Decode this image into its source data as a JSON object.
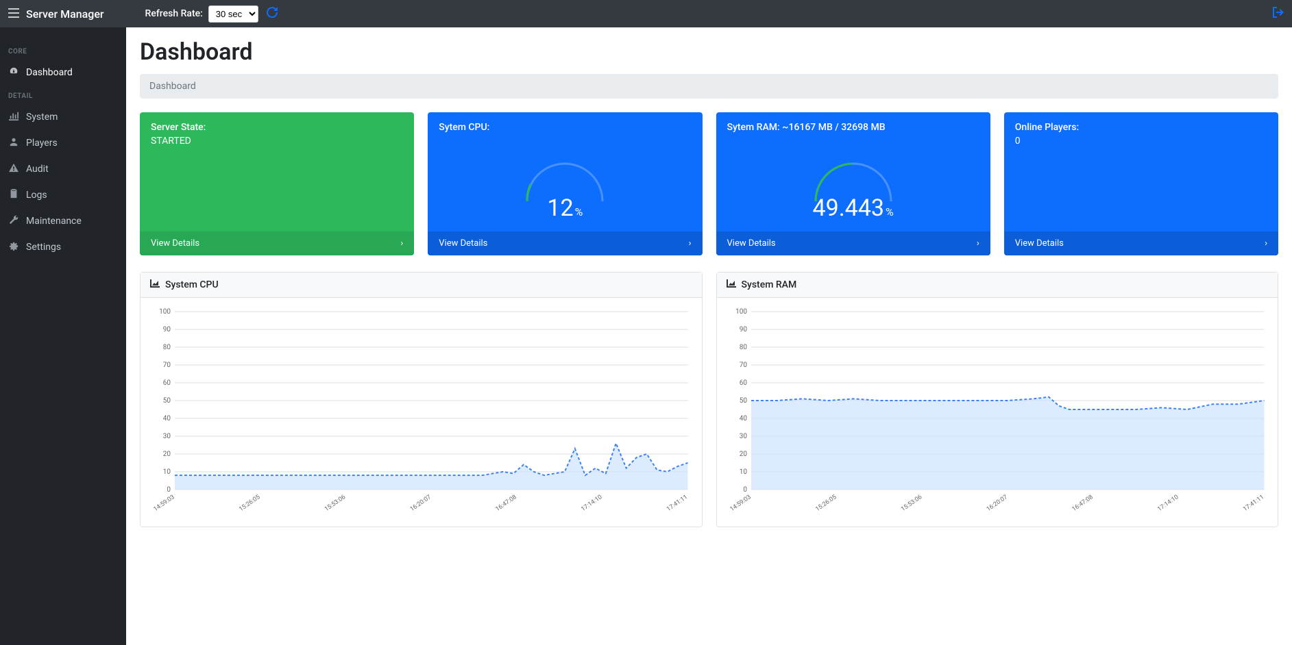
{
  "header": {
    "brand": "Server Manager",
    "refresh_label": "Refresh Rate:",
    "refresh_selected": "30 sec"
  },
  "sidebar": {
    "sections": [
      {
        "label": "CORE",
        "items": [
          {
            "icon": "gauge-icon",
            "label": "Dashboard",
            "active": true
          }
        ]
      },
      {
        "label": "DETAIL",
        "items": [
          {
            "icon": "chart-icon",
            "label": "System"
          },
          {
            "icon": "user-icon",
            "label": "Players"
          },
          {
            "icon": "warn-icon",
            "label": "Audit"
          },
          {
            "icon": "clipboard-icon",
            "label": "Logs"
          },
          {
            "icon": "wrench-icon",
            "label": "Maintenance"
          },
          {
            "icon": "cogs-icon",
            "label": "Settings"
          }
        ]
      }
    ]
  },
  "page": {
    "title": "Dashboard",
    "breadcrumb": "Dashboard"
  },
  "cards": {
    "server_state": {
      "title": "Server State:",
      "value": "STARTED",
      "footer": "View Details"
    },
    "cpu": {
      "title": "Sytem CPU:",
      "value": "12",
      "unit": "%",
      "footer": "View Details"
    },
    "ram": {
      "title": "Sytem RAM: ~16167 MB / 32698 MB",
      "value": "49.443",
      "unit": "%",
      "footer": "View Details"
    },
    "players": {
      "title": "Online Players:",
      "value": "0",
      "footer": "View Details"
    }
  },
  "chart_panels": {
    "cpu_title": "System CPU",
    "ram_title": "System RAM"
  },
  "chart_data": [
    {
      "id": "cpu",
      "type": "area",
      "title": "System CPU",
      "ylabel": "",
      "xlabel": "",
      "ylim": [
        0,
        100
      ],
      "y_ticks": [
        0,
        10,
        20,
        30,
        40,
        50,
        60,
        70,
        80,
        90,
        100
      ],
      "x_ticks": [
        "14:59:03",
        "15:26:05",
        "15:53:06",
        "16:20:07",
        "16:47:08",
        "17:14:10",
        "17:41:11"
      ],
      "x": [
        0,
        5,
        10,
        15,
        20,
        25,
        30,
        35,
        40,
        45,
        50,
        55,
        60,
        62,
        64,
        66,
        68,
        70,
        72,
        74,
        76,
        78,
        80,
        82,
        84,
        86,
        88,
        90,
        92,
        94,
        96,
        98,
        100
      ],
      "values": [
        8,
        8,
        8,
        8,
        8,
        8,
        8,
        8,
        8,
        8,
        8,
        8,
        8,
        9,
        10,
        9,
        14,
        10,
        8,
        9,
        10,
        23,
        8,
        12,
        9,
        26,
        12,
        18,
        20,
        11,
        10,
        13,
        15
      ]
    },
    {
      "id": "ram",
      "type": "area",
      "title": "System RAM",
      "ylabel": "",
      "xlabel": "",
      "ylim": [
        0,
        100
      ],
      "y_ticks": [
        0,
        10,
        20,
        30,
        40,
        50,
        60,
        70,
        80,
        90,
        100
      ],
      "x_ticks": [
        "14:59:03",
        "15:26:05",
        "15:53:06",
        "16:20:07",
        "16:47:08",
        "17:14:10",
        "17:41:11"
      ],
      "x": [
        0,
        5,
        10,
        15,
        20,
        25,
        30,
        35,
        40,
        45,
        50,
        55,
        58,
        60,
        62,
        65,
        70,
        75,
        80,
        85,
        90,
        95,
        100
      ],
      "values": [
        50,
        50,
        51,
        50,
        51,
        50,
        50,
        50,
        50,
        50,
        50,
        51,
        52,
        47,
        45,
        45,
        45,
        45,
        46,
        45,
        48,
        48,
        50
      ]
    }
  ]
}
